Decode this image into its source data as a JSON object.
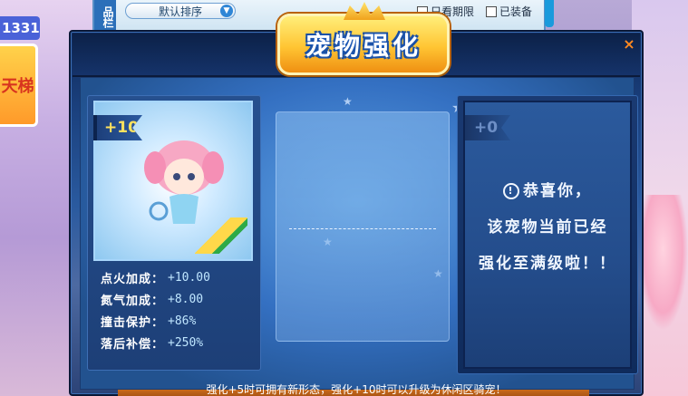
{
  "background": {
    "left_banner_number": "1331",
    "left_banner_text": "天梯",
    "sidebar_tab": "品栏",
    "sort_select": "默认排序",
    "checkbox_expiry": "只看期限",
    "checkbox_equipped": "已装备"
  },
  "modal": {
    "title": "宠物强化",
    "close": "×",
    "pet": {
      "level": "+10",
      "stats": [
        {
          "label": "点火加成：",
          "value": "+10.00"
        },
        {
          "label": "氮气加成：",
          "value": "+8.00"
        },
        {
          "label": "撞击保护：",
          "value": "+86%"
        },
        {
          "label": "落后补偿：",
          "value": "+250%"
        }
      ]
    },
    "result": {
      "level": "+0",
      "line1": "恭喜你，",
      "line2": "该宠物当前已经",
      "line3": "强化至满级啦！！"
    },
    "hint": "强化+5时可拥有新形态，强化+10时可以升级为休闲区骑宠！"
  },
  "colors": {
    "accent_gold": "#ffc533",
    "panel_blue": "#2a5a9f",
    "close_orange": "#ff8a20"
  }
}
